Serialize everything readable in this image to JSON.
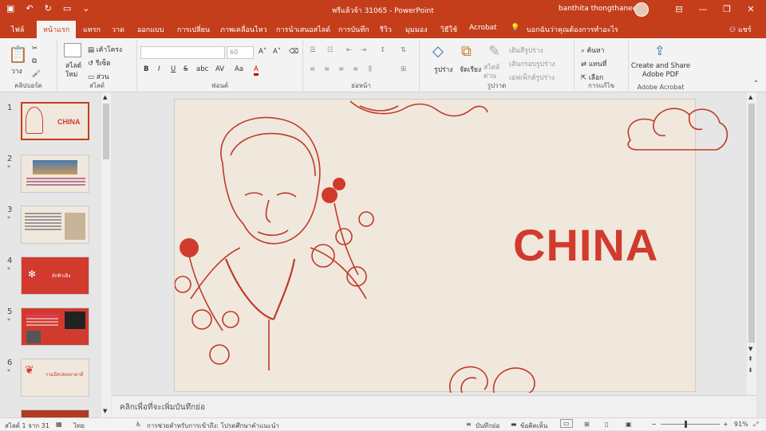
{
  "titlebar": {
    "doc_title": "พรีแล้วจ้า 31065  -  PowerPoint",
    "user_name": "banthita thongthanee",
    "minimize": "—",
    "restore": "❐",
    "close": "✕"
  },
  "tabs": [
    "ไฟล์",
    "หน้าแรก",
    "แทรก",
    "วาด",
    "ออกแบบ",
    "การเปลี่ยน",
    "ภาพเคลื่อนไหว",
    "การนำเสนอสไลด์",
    "การบันทึก",
    "รีวิว",
    "มุมมอง",
    "วิธีใช้",
    "Acrobat"
  ],
  "active_tab": "หน้าแรก",
  "tell_me": "บอกฉันว่าคุณต้องการทำอะไร",
  "share": "แชร์",
  "ribbon": {
    "clipboard": {
      "paste": "วาง",
      "label": "คลิปบอร์ด"
    },
    "slides": {
      "new_slide": "สไลด์ใหม่",
      "layout": "เค้าโครง",
      "reset": "รีเซ็ต",
      "section": "ส่วน",
      "label": "สไลด์"
    },
    "font": {
      "font_size": "60",
      "label": "ฟอนต์",
      "bold": "B",
      "italic": "I",
      "underline": "U",
      "strike": "S",
      "shadow": "abc",
      "spacing": "AV",
      "case": "Aa",
      "color": "A"
    },
    "paragraph": {
      "label": "ย่อหน้า"
    },
    "drawing": {
      "shapes": "รูปร่าง",
      "arrange": "จัดเรียง",
      "quick_styles": "สไตล์ด่วน",
      "fill": "เติมสีรูปร่าง",
      "outline": "เส้นกรอบรูปร่าง",
      "effects": "เอฟเฟ็กต์รูปร่าง",
      "label": "รูปวาด"
    },
    "editing": {
      "find": "ค้นหา",
      "replace": "แทนที่",
      "select": "เลือก",
      "label": "การแก้ไข"
    },
    "acrobat": {
      "create_share": "Create and Share Adobe PDF",
      "label": "Adobe Acrobat"
    }
  },
  "slides": [
    {
      "number": "1",
      "title": "CHINA",
      "star": ""
    },
    {
      "number": "2",
      "title": "",
      "star": "*"
    },
    {
      "number": "3",
      "title": "",
      "star": "*"
    },
    {
      "number": "4",
      "title": "ถักทิวเลิง",
      "star": "*"
    },
    {
      "number": "5",
      "title": "",
      "star": "*"
    },
    {
      "number": "6",
      "title": "รวมอีสปทยหาตาดี",
      "star": "*"
    }
  ],
  "main_slide": {
    "title": "CHINA"
  },
  "notes_placeholder": "คลิกเพื่อที่จะเพิ่มบันทึกย่อ",
  "status": {
    "slide_info": "สไลด์ 1 จาก 31",
    "language": "ไทย",
    "accessibility": "การช่วยสำหรับการเข้าถึง: โปรดศึกษาคำแนะนำ",
    "notes_btn": "บันทึกย่อ",
    "comments_btn": "ข้อคิดเห็น",
    "zoom": "91%"
  },
  "colors": {
    "accent": "#c43e1c",
    "slide_red": "#d13b2e",
    "slide_bg": "#f0e8dc"
  }
}
